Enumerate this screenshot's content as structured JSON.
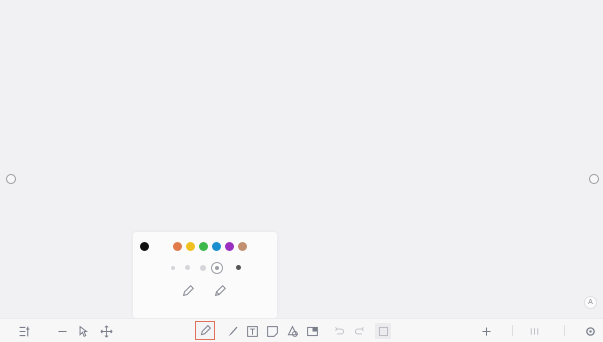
{
  "colors": {
    "accent": "#e0705a",
    "icon": "#7a7d8a",
    "swatches": [
      "#111111",
      "#e07a4a",
      "#f0c020",
      "#3db84a",
      "#1a8fd0",
      "#9a2fc0",
      "#c09070"
    ]
  },
  "canvas": {
    "handles": [
      "resize-handle-left",
      "resize-handle-right"
    ]
  },
  "pen_panel": {
    "selected_color": "#111111",
    "tools": [
      "pen-icon",
      "highlighter-icon"
    ]
  },
  "corner_button": {
    "label": "A"
  },
  "toolbar": {
    "left": [
      "page-list-icon",
      "minus-icon",
      "pointer-icon",
      "move-icon"
    ],
    "center": [
      "pen-icon",
      "brush-icon",
      "text-icon",
      "note-icon",
      "shape-icon",
      "image-icon",
      "undo-icon",
      "redo-icon",
      "more-icon"
    ],
    "right": [
      "add-page-icon",
      "page-count-icon",
      "settings-icon"
    ],
    "active": "pen-icon"
  }
}
